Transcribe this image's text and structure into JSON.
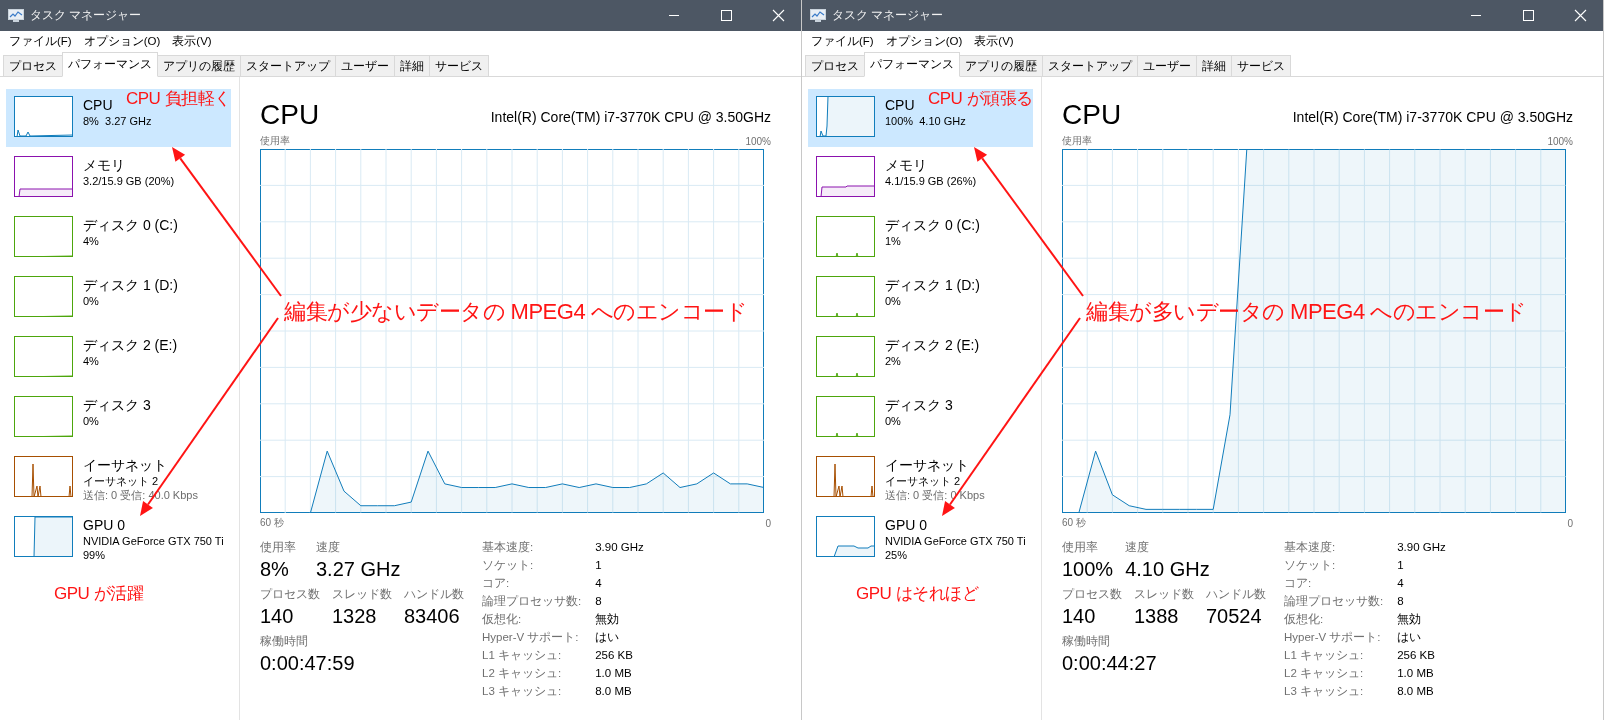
{
  "windows": [
    {
      "title": "タスク マネージャー",
      "menu": [
        "ファイル(F)",
        "オプション(O)",
        "表示(V)"
      ],
      "tabs": [
        {
          "label": "プロセス",
          "selected": false
        },
        {
          "label": "パフォーマンス",
          "selected": true
        },
        {
          "label": "アプリの履歴",
          "selected": false
        },
        {
          "label": "スタートアップ",
          "selected": false
        },
        {
          "label": "ユーザー",
          "selected": false
        },
        {
          "label": "詳細",
          "selected": false
        },
        {
          "label": "サービス",
          "selected": false
        }
      ],
      "sidebar": {
        "items": [
          {
            "kind": "cpu",
            "name": "CPU",
            "lines": [
              "8%  3.27 GHz"
            ],
            "selected": true,
            "color": "#117dbb"
          },
          {
            "kind": "memory",
            "name": "メモリ",
            "lines": [
              "3.2/15.9 GB (20%)"
            ],
            "selected": false,
            "color": "#8b12ae"
          },
          {
            "kind": "disk",
            "name": "ディスク 0 (C:)",
            "lines": [
              "4%"
            ],
            "selected": false,
            "color": "#4da60c"
          },
          {
            "kind": "disk",
            "name": "ディスク 1 (D:)",
            "lines": [
              "0%"
            ],
            "selected": false,
            "color": "#4da60c"
          },
          {
            "kind": "disk",
            "name": "ディスク 2 (E:)",
            "lines": [
              "4%"
            ],
            "selected": false,
            "color": "#4da60c"
          },
          {
            "kind": "disk",
            "name": "ディスク 3",
            "lines": [
              "0%"
            ],
            "selected": false,
            "color": "#4da60c"
          },
          {
            "kind": "ethernet",
            "name": "イーサネット",
            "lines": [
              "イーサネット 2",
              "送信: 0 受信: 40.0 Kbps"
            ],
            "selected": false,
            "color": "#a74f01"
          },
          {
            "kind": "gpu",
            "name": "GPU 0",
            "lines": [
              "NVIDIA GeForce GTX 750 Ti",
              "99%"
            ],
            "selected": false,
            "color": "#117dbb"
          }
        ]
      },
      "panel": {
        "title": "CPU",
        "model": "Intel(R) Core(TM) i7-3770K CPU @ 3.50GHz",
        "graph": {
          "usage_label": "使用率",
          "max_label": "100%",
          "span_label": "60 秒",
          "zero_label": "0"
        },
        "stat_rows": [
          [
            {
              "label": "使用率",
              "value": "8%"
            },
            {
              "label": "速度",
              "value": "3.27 GHz"
            }
          ],
          [
            {
              "label": "プロセス数",
              "value": "140"
            },
            {
              "label": "スレッド数",
              "value": "1328"
            },
            {
              "label": "ハンドル数",
              "value": "83406"
            }
          ],
          [
            {
              "label": "稼働時間",
              "value": "0:00:47:59"
            }
          ]
        ],
        "details": [
          {
            "label": "基本速度:",
            "value": "3.90 GHz"
          },
          {
            "label": "ソケット:",
            "value": "1"
          },
          {
            "label": "コア:",
            "value": "4"
          },
          {
            "label": "論理プロセッサ数:",
            "value": "8"
          },
          {
            "label": "仮想化:",
            "value": "無効"
          },
          {
            "label": "Hyper-V サポート:",
            "value": "はい"
          },
          {
            "label": "L1 キャッシュ:",
            "value": "256 KB"
          },
          {
            "label": "L2 キャッシュ:",
            "value": "1.0 MB"
          },
          {
            "label": "L3 キャッシュ:",
            "value": "8.0 MB"
          }
        ]
      },
      "annotations": [
        {
          "kind": "top",
          "text": "CPU 負担軽く"
        },
        {
          "kind": "center",
          "text": "編集が少ないデータの MPEG4 へのエンコード"
        },
        {
          "kind": "bottom",
          "text": "GPU が活躍"
        }
      ]
    },
    {
      "title": "タスク マネージャー",
      "menu": [
        "ファイル(F)",
        "オプション(O)",
        "表示(V)"
      ],
      "tabs": [
        {
          "label": "プロセス",
          "selected": false
        },
        {
          "label": "パフォーマンス",
          "selected": true
        },
        {
          "label": "アプリの履歴",
          "selected": false
        },
        {
          "label": "スタートアップ",
          "selected": false
        },
        {
          "label": "ユーザー",
          "selected": false
        },
        {
          "label": "詳細",
          "selected": false
        },
        {
          "label": "サービス",
          "selected": false
        }
      ],
      "sidebar": {
        "items": [
          {
            "kind": "cpu",
            "name": "CPU",
            "lines": [
              "100%  4.10 GHz"
            ],
            "selected": true,
            "color": "#117dbb"
          },
          {
            "kind": "memory",
            "name": "メモリ",
            "lines": [
              "4.1/15.9 GB (26%)"
            ],
            "selected": false,
            "color": "#8b12ae"
          },
          {
            "kind": "disk",
            "name": "ディスク 0 (C:)",
            "lines": [
              "1%"
            ],
            "selected": false,
            "color": "#4da60c"
          },
          {
            "kind": "disk",
            "name": "ディスク 1 (D:)",
            "lines": [
              "0%"
            ],
            "selected": false,
            "color": "#4da60c"
          },
          {
            "kind": "disk",
            "name": "ディスク 2 (E:)",
            "lines": [
              "2%"
            ],
            "selected": false,
            "color": "#4da60c"
          },
          {
            "kind": "disk",
            "name": "ディスク 3",
            "lines": [
              "0%"
            ],
            "selected": false,
            "color": "#4da60c"
          },
          {
            "kind": "ethernet",
            "name": "イーサネット",
            "lines": [
              "イーサネット 2",
              "送信: 0 受信: 0 Kbps"
            ],
            "selected": false,
            "color": "#a74f01"
          },
          {
            "kind": "gpu",
            "name": "GPU 0",
            "lines": [
              "NVIDIA GeForce GTX 750 Ti",
              "25%"
            ],
            "selected": false,
            "color": "#117dbb"
          }
        ]
      },
      "panel": {
        "title": "CPU",
        "model": "Intel(R) Core(TM) i7-3770K CPU @ 3.50GHz",
        "graph": {
          "usage_label": "使用率",
          "max_label": "100%",
          "span_label": "60 秒",
          "zero_label": "0"
        },
        "stat_rows": [
          [
            {
              "label": "使用率",
              "value": "100%"
            },
            {
              "label": "速度",
              "value": "4.10 GHz"
            }
          ],
          [
            {
              "label": "プロセス数",
              "value": "140"
            },
            {
              "label": "スレッド数",
              "value": "1388"
            },
            {
              "label": "ハンドル数",
              "value": "70524"
            }
          ],
          [
            {
              "label": "稼働時間",
              "value": "0:00:44:27"
            }
          ]
        ],
        "details": [
          {
            "label": "基本速度:",
            "value": "3.90 GHz"
          },
          {
            "label": "ソケット:",
            "value": "1"
          },
          {
            "label": "コア:",
            "value": "4"
          },
          {
            "label": "論理プロセッサ数:",
            "value": "8"
          },
          {
            "label": "仮想化:",
            "value": "無効"
          },
          {
            "label": "Hyper-V サポート:",
            "value": "はい"
          },
          {
            "label": "L1 キャッシュ:",
            "value": "256 KB"
          },
          {
            "label": "L2 キャッシュ:",
            "value": "1.0 MB"
          },
          {
            "label": "L3 キャッシュ:",
            "value": "8.0 MB"
          }
        ]
      },
      "annotations": [
        {
          "kind": "top",
          "text": "CPU が頑張る"
        },
        {
          "kind": "center",
          "text": "編集が多いデータの MPEG4 へのエンコード"
        },
        {
          "kind": "bottom",
          "text": "GPU はそれほど"
        }
      ]
    }
  ]
}
